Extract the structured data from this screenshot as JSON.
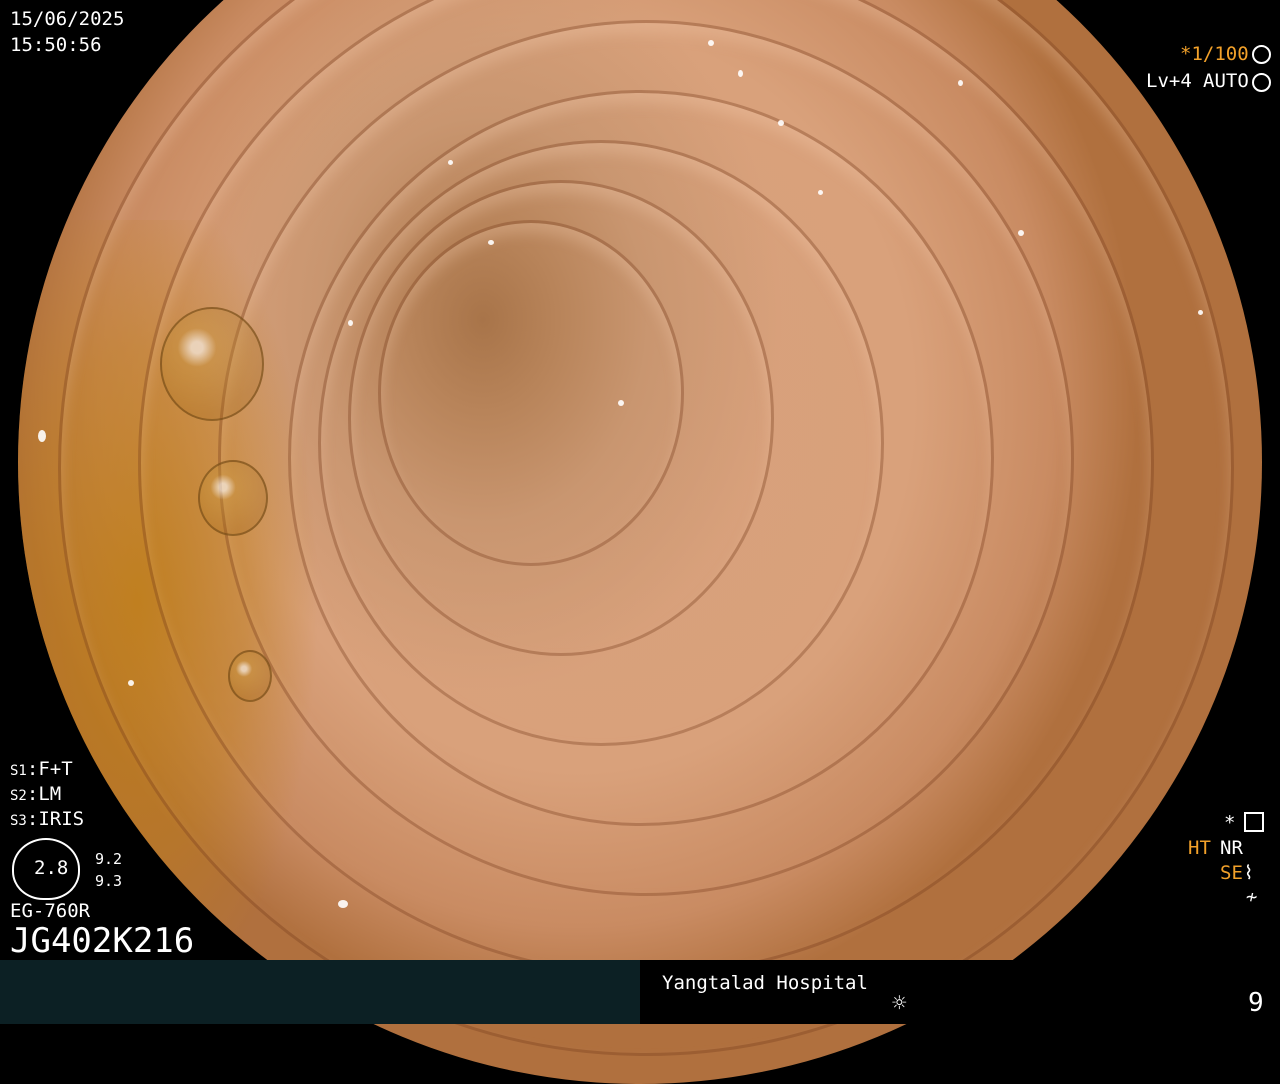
{
  "datetime": {
    "date": "15/06/2025",
    "time": "15:50:56"
  },
  "top_right": {
    "shutter": "*1/100",
    "level": "Lv+4",
    "auto": "AUTO"
  },
  "settings": {
    "s1_key": "S1",
    "s1_value": "F+T",
    "s2_key": "S2",
    "s2_value": "LM",
    "s3_key": "S3",
    "s3_value": "IRIS"
  },
  "lens": {
    "value": "2.8",
    "side_top": "9.2",
    "side_bottom": "9.3"
  },
  "scope": {
    "model": "EG-760R",
    "serial": "JG402K216"
  },
  "right_panel": {
    "star": "*",
    "ht": "HT",
    "nr": "NR",
    "se": "SE",
    "sym": "≁"
  },
  "footer": {
    "hospital": "Yangtalad Hospital",
    "counter": "9",
    "icon": "sun-icon"
  },
  "colors": {
    "accent_orange": "#f2a12a",
    "footer_bg": "#0c2024"
  }
}
